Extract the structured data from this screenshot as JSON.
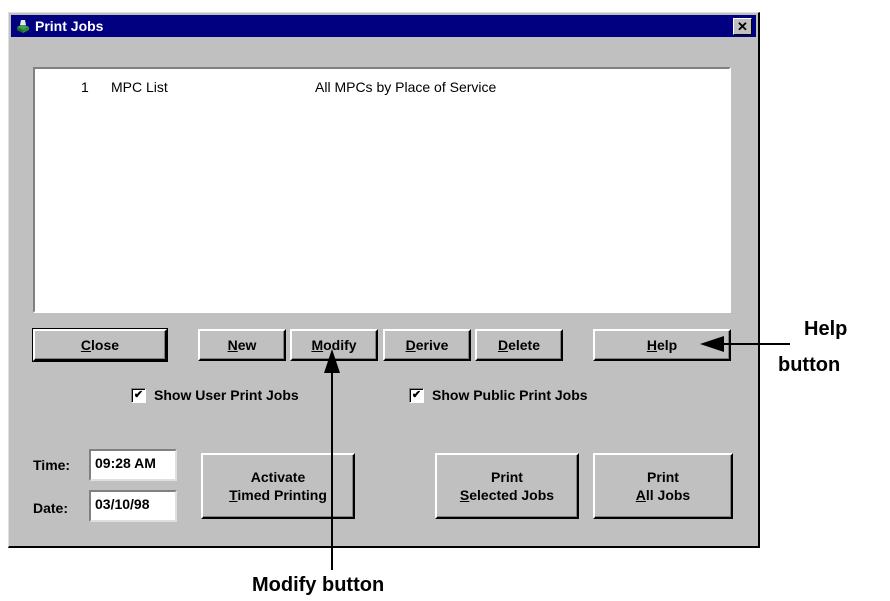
{
  "window": {
    "title": "Print Jobs",
    "close_glyph": "✕"
  },
  "jobs": [
    {
      "number": "1",
      "name": "MPC List",
      "description": "All MPCs by Place of Service"
    }
  ],
  "buttons": {
    "close": {
      "pre": "",
      "u": "C",
      "post": "lose"
    },
    "new": {
      "pre": "",
      "u": "N",
      "post": "ew"
    },
    "modify": {
      "pre": "",
      "u": "M",
      "post": "odify"
    },
    "derive": {
      "pre": "",
      "u": "D",
      "post": "erive"
    },
    "delete": {
      "pre": "",
      "u": "D",
      "post": "elete"
    },
    "help": {
      "pre": "",
      "u": "H",
      "post": "elp"
    },
    "activate_line1": "Activate",
    "activate_u": "T",
    "activate_line2_rest": "imed Printing",
    "print_selected_line1": "Print",
    "print_selected_u": "S",
    "print_selected_rest": "elected Jobs",
    "print_all_line1": "Print",
    "print_all_u": "A",
    "print_all_rest": "ll Jobs"
  },
  "checkboxes": {
    "user": {
      "label": "Show User Print Jobs",
      "checked": true
    },
    "public": {
      "label": "Show Public Print Jobs",
      "checked": true
    }
  },
  "fields": {
    "time_label": "Time:",
    "time_value": "09:28 AM",
    "date_label": "Date:",
    "date_value": "03/10/98"
  },
  "annotations": {
    "help_line1": "Help",
    "help_line2": "button",
    "modify": "Modify button"
  },
  "colors": {
    "titlebar": "#000080",
    "face": "#c0c0c0"
  },
  "icons": {
    "title_icon": "printer-app-icon",
    "check": "✔"
  }
}
